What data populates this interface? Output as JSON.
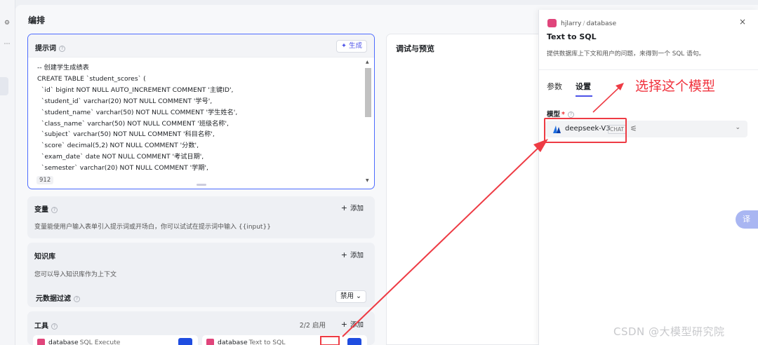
{
  "page": {
    "title": "编排"
  },
  "prompt": {
    "title": "提示词",
    "generate_label": "生成",
    "char_count": "912",
    "code_lines": [
      "-- 创建学生成绩表",
      "CREATE TABLE `student_scores` (",
      "  `id` bigint NOT NULL AUTO_INCREMENT COMMENT '主键ID',",
      "  `student_id` varchar(20) NOT NULL COMMENT '学号',",
      "  `student_name` varchar(50) NOT NULL COMMENT '学生姓名',",
      "  `class_name` varchar(50) NOT NULL COMMENT '班级名称',",
      "  `subject` varchar(50) NOT NULL COMMENT '科目名称',",
      "  `score` decimal(5,2) NOT NULL COMMENT '分数',",
      "  `exam_date` date NOT NULL COMMENT '考试日期',",
      "  `semester` varchar(20) NOT NULL COMMENT '学期',"
    ]
  },
  "variables": {
    "title": "变量",
    "add_label": "添加",
    "description": "变量能使用户输入表单引入提示词或开场白，你可以试试在提示词中输入 {{input}}"
  },
  "knowledge": {
    "title": "知识库",
    "add_label": "添加",
    "description": "您可以导入知识库作为上下文",
    "metadata_filter_label": "元数据过滤",
    "metadata_filter_value": "禁用"
  },
  "tools": {
    "title": "工具",
    "enabled_count": "2/2 启用",
    "add_label": "添加",
    "items": [
      {
        "provider": "database",
        "name": "SQL Execute"
      },
      {
        "provider": "database",
        "name": "Text to SQL"
      }
    ]
  },
  "preview": {
    "title": "调试与预览"
  },
  "drawer": {
    "breadcrumb_user": "hjlarry",
    "breadcrumb_sep": "/",
    "breadcrumb_plugin": "database",
    "close_icon": "×",
    "title": "Text to SQL",
    "subtitle": "提供数据库上下文和用户的问题，来得到一个 SQL 语句。",
    "tabs": [
      "参数",
      "设置"
    ],
    "active_tab": "设置",
    "model_label": "模型",
    "required_mark": "*",
    "model_name": "deepseek-V3",
    "model_badge": "CHAT"
  },
  "annotation": {
    "text": "选择这个模型",
    "color": "#f0323d"
  },
  "float_button": {
    "label": "译"
  },
  "watermark": "CSDN @大模型研究院",
  "colors": {
    "accent": "#4d53e8",
    "annotation_red": "#ee3b44",
    "database_icon": "#e0457b",
    "toggle_blue": "#1f4de0"
  }
}
